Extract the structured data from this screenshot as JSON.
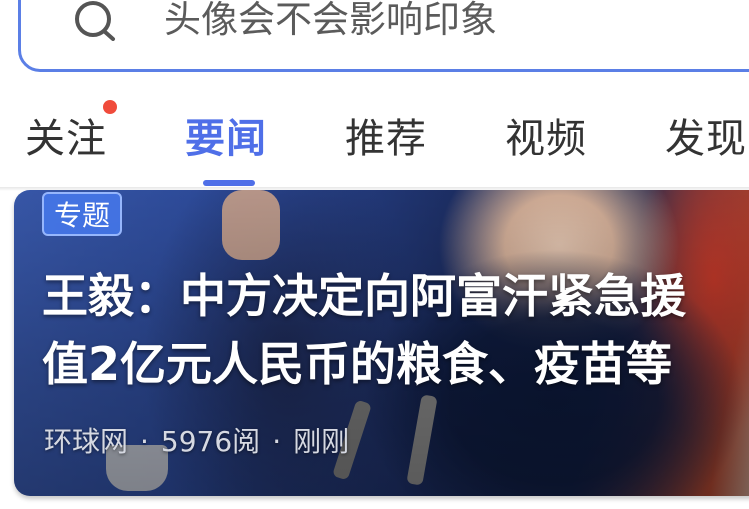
{
  "search": {
    "placeholder": "头像会不会影响印象"
  },
  "tabs": [
    {
      "label": "关注"
    },
    {
      "label": "要闻"
    },
    {
      "label": "推荐"
    },
    {
      "label": "视频"
    },
    {
      "label": "发现"
    }
  ],
  "active_tab": "要闻",
  "colors": {
    "accent": "#4f6fe8",
    "badge": "#f04b3b"
  },
  "news_card": {
    "tag": "专题",
    "headline_line1": "王毅：中方决定向阿富汗紧急援",
    "headline_line2": "值2亿元人民币的粮食、疫苗等",
    "source": "环球网",
    "separator": "·",
    "reads": "5976阅",
    "time": "刚刚"
  }
}
